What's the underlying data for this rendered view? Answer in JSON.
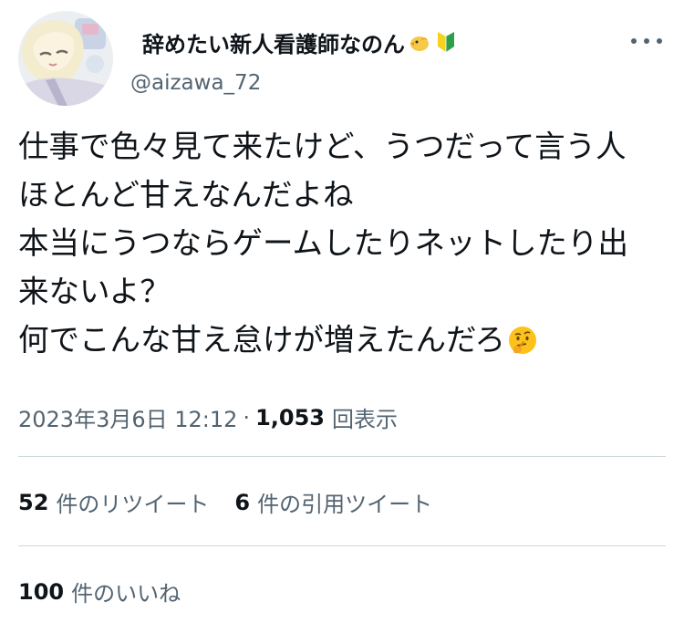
{
  "author": {
    "display_name": "辞めたい新人看護師なのん",
    "handle": "@aizawa_72",
    "emoji_1": "chick-emoji",
    "emoji_2": "beginner-mark-emoji"
  },
  "tweet": {
    "lines": [
      "仕事で色々見て来たけど、うつだって言う人",
      "ほとんど甘えなんだよね",
      "本当にうつならゲームしたりネットしたり出",
      "来ないよ？",
      "何でこんな甘え怠けが増えたんだろ"
    ],
    "trailing_emoji": "thinking-face-emoji"
  },
  "meta": {
    "date": "2023年3月6日 12:12",
    "separator": "·",
    "views_count": "1,053",
    "views_label": "回表示"
  },
  "stats": {
    "retweets_count": "52",
    "retweets_label": "件のリツイート",
    "quotes_count": "6",
    "quotes_label": "件の引用ツイート",
    "likes_count": "100",
    "likes_label": "件のいいね"
  },
  "colors": {
    "text": "#0f1419",
    "secondary": "#536471",
    "divider": "#cfd9de",
    "background": "#ffffff"
  }
}
